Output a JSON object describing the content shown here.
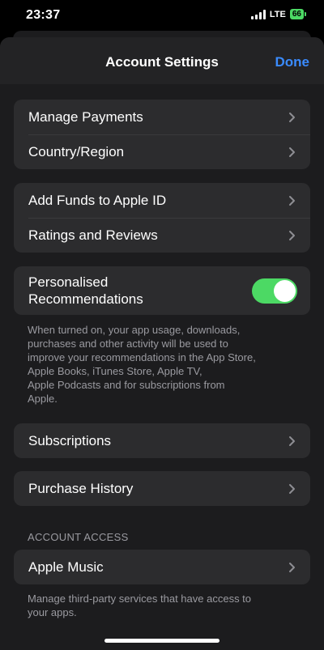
{
  "status_bar": {
    "time": "23:37",
    "network": "LTE",
    "battery": "66"
  },
  "navbar": {
    "title": "Account Settings",
    "done_label": "Done"
  },
  "group_payments": {
    "items": [
      {
        "label": "Manage Payments"
      },
      {
        "label": "Country/Region"
      }
    ]
  },
  "group_funds": {
    "items": [
      {
        "label": "Add Funds to Apple ID"
      },
      {
        "label": "Ratings and Reviews"
      }
    ]
  },
  "personalised": {
    "label_line1": "Personalised",
    "label_line2": "Recommendations",
    "enabled": true,
    "footnote_lines": [
      "When turned on, your app usage, downloads,",
      "purchases and other activity will be used to",
      "improve your recommendations in the App Store,",
      "Apple Books, iTunes Store, Apple TV,",
      "Apple Podcasts and for subscriptions from",
      "Apple."
    ]
  },
  "subscriptions": {
    "label": "Subscriptions"
  },
  "purchase_history": {
    "label": "Purchase History"
  },
  "account_access": {
    "header": "ACCOUNT ACCESS",
    "item_label": "Apple Music",
    "footnote_lines": [
      "Manage third-party services that have access to",
      "your apps."
    ]
  },
  "colors": {
    "accent": "#3a8bff",
    "toggle_on": "#4cd964"
  }
}
